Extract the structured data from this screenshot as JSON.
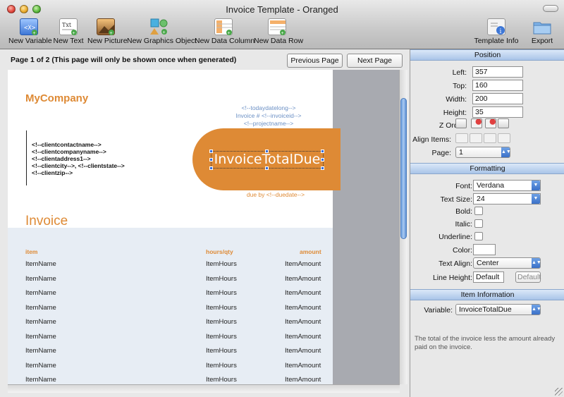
{
  "window": {
    "title": "Invoice Template - Oranged"
  },
  "toolbar": {
    "new_variable": "New Variable",
    "new_text": "New Text",
    "new_picture": "New Picture",
    "new_graphics_object": "New Graphics Object",
    "new_data_column": "New Data Column",
    "new_data_row": "New Data Row",
    "template_info": "Template Info",
    "export": "Export"
  },
  "pagebar": {
    "page_info": "Page 1 of 2   (This page will only be shown once when generated)",
    "previous_page": "Previous Page",
    "next_page": "Next Page"
  },
  "document": {
    "company": "MyCompany",
    "header_tags": [
      "<!--todaydatelong-->",
      "Invoice # <!--invoiceid-->",
      "<!--projectname-->"
    ],
    "client_lines": [
      "<!--clientcontactname-->",
      "<!--clientcompanyname-->",
      "<!--clientaddress1-->",
      "<!--clientcity-->, <!--clientstate-->",
      "<!--clientzip-->"
    ],
    "total_due": "InvoiceTotalDue",
    "due_date": "due by <!--duedate-->",
    "invoice_heading": "Invoice",
    "columns": {
      "item": "item",
      "hours": "hours/qty",
      "amount": "amount"
    },
    "rows": [
      {
        "name": "ItemName",
        "hours": "ItemHours",
        "amount": "ItemAmount"
      },
      {
        "name": "ItemName",
        "hours": "ItemHours",
        "amount": "ItemAmount"
      },
      {
        "name": "ItemName",
        "hours": "ItemHours",
        "amount": "ItemAmount"
      },
      {
        "name": "ItemName",
        "hours": "ItemHours",
        "amount": "ItemAmount"
      },
      {
        "name": "ItemName",
        "hours": "ItemHours",
        "amount": "ItemAmount"
      },
      {
        "name": "ItemName",
        "hours": "ItemHours",
        "amount": "ItemAmount"
      },
      {
        "name": "ItemName",
        "hours": "ItemHours",
        "amount": "ItemAmount"
      },
      {
        "name": "ItemName",
        "hours": "ItemHours",
        "amount": "ItemAmount"
      },
      {
        "name": "ItemName",
        "hours": "ItemHours",
        "amount": "ItemAmount"
      }
    ]
  },
  "inspector": {
    "position": {
      "header": "Position",
      "left_label": "Left:",
      "left_value": "357",
      "top_label": "Top:",
      "top_value": "160",
      "width_label": "Width:",
      "width_value": "200",
      "height_label": "Height:",
      "height_value": "35",
      "zorder_label": "Z Order:",
      "align_label": "Align Items:",
      "page_label": "Page:",
      "page_value": "1"
    },
    "formatting": {
      "header": "Formatting",
      "font_label": "Font:",
      "font_value": "Verdana",
      "size_label": "Text Size:",
      "size_value": "24",
      "bold_label": "Bold:",
      "italic_label": "Italic:",
      "underline_label": "Underline:",
      "color_label": "Color:",
      "align_label": "Text Align:",
      "align_value": "Center",
      "line_height_label": "Line Height:",
      "line_height_value": "Default",
      "line_height_button": "Default"
    },
    "item_info": {
      "header": "Item Information",
      "variable_label": "Variable:",
      "variable_value": "InvoiceTotalDue",
      "description": "The total of the invoice less the amount already paid on the invoice."
    }
  },
  "colors": {
    "accent": "#de8a35",
    "tag_blue": "#6b90c5",
    "lower_bg": "#e7edf4"
  }
}
